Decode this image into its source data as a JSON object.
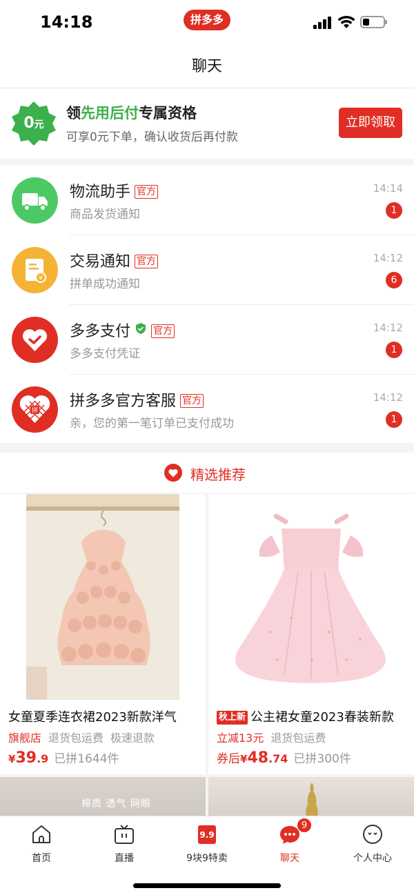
{
  "status_bar": {
    "time": "14:18",
    "app_logo": "拼多多"
  },
  "header": {
    "title": "聊天"
  },
  "promo": {
    "badge_main": "0",
    "badge_unit": "元",
    "title_prefix": "领",
    "title_highlight": "先用后付",
    "title_suffix": "专属资格",
    "subtitle": "可享0元下单，确认收货后再付款",
    "button_label": "立即领取"
  },
  "chats": [
    {
      "name": "物流助手",
      "tag": "官方",
      "preview": "商品发货通知",
      "time": "14:14",
      "unread": "1",
      "icon": "truck-icon",
      "color": "#4cc964"
    },
    {
      "name": "交易通知",
      "tag": "官方",
      "preview": "拼单成功通知",
      "time": "14:12",
      "unread": "6",
      "icon": "receipt-icon",
      "color": "#f5b335"
    },
    {
      "name": "多多支付",
      "tag": "官方",
      "preview": "多多支付凭证",
      "time": "14:12",
      "unread": "1",
      "icon": "heart-pay-icon",
      "color": "#e02e24",
      "verified": true
    },
    {
      "name": "拼多多官方客服",
      "tag": "官方",
      "preview": "亲，您的第一笔订单已支付成功",
      "time": "14:12",
      "unread": "1",
      "icon": "pdd-logo-icon",
      "color": "#e02e24"
    }
  ],
  "recommend": {
    "title": "精选推荐"
  },
  "products": [
    {
      "name": "女童夏季连衣裙2023新款洋气",
      "tag_new": "",
      "tags": [
        {
          "text": "旗舰店",
          "style": "red"
        },
        {
          "text": "退货包运费",
          "style": "gray"
        },
        {
          "text": "极速退款",
          "style": "gray"
        }
      ],
      "price_prefix": "",
      "currency": "¥",
      "price_int": "39",
      "price_dec": ".9",
      "sold": "已拼1644件"
    },
    {
      "name": "公主裙女童2023春装新款",
      "tag_new": "秋上新",
      "tags": [
        {
          "text": "立减13元",
          "style": "red"
        },
        {
          "text": "退货包运费",
          "style": "gray"
        }
      ],
      "price_prefix": "券后",
      "currency": "¥",
      "price_int": "48",
      "price_dec": ".74",
      "sold": "已拼300件"
    }
  ],
  "peek": {
    "left_text": "棉质 透气 网眼"
  },
  "tabs": [
    {
      "label": "首页",
      "icon": "home-icon",
      "active": false
    },
    {
      "label": "直播",
      "icon": "tv-icon",
      "active": false
    },
    {
      "label": "9块9特卖",
      "icon": "nine-nine-icon",
      "active": false,
      "icon_text": "9.9"
    },
    {
      "label": "聊天",
      "icon": "chat-icon",
      "active": true,
      "badge": "9"
    },
    {
      "label": "个人中心",
      "icon": "profile-icon",
      "active": false
    }
  ],
  "colors": {
    "brand_red": "#e02e24",
    "green": "#3cb04a"
  }
}
